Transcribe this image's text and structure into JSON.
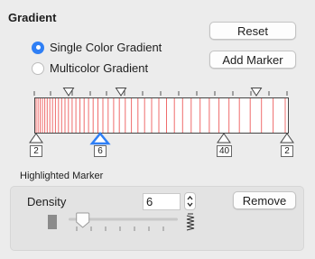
{
  "panel": {
    "title": "Gradient",
    "reset_label": "Reset",
    "add_marker_label": "Add Marker"
  },
  "gradient_type": {
    "options": [
      {
        "label": "Single Color Gradient",
        "selected": true
      },
      {
        "label": "Multicolor Gradient",
        "selected": false
      }
    ]
  },
  "gradient_bar": {
    "stripe_color": "#ef6c6c",
    "selected_marker_color": "#2f7ff5",
    "density_markers": [
      "2",
      "6",
      "40",
      "2"
    ],
    "selected_marker_index": 1
  },
  "highlighted_marker": {
    "section_label": "Highlighted Marker",
    "density_label": "Density",
    "density_value": "6",
    "remove_label": "Remove"
  },
  "density_slider": {
    "level_fraction": 0.13
  }
}
